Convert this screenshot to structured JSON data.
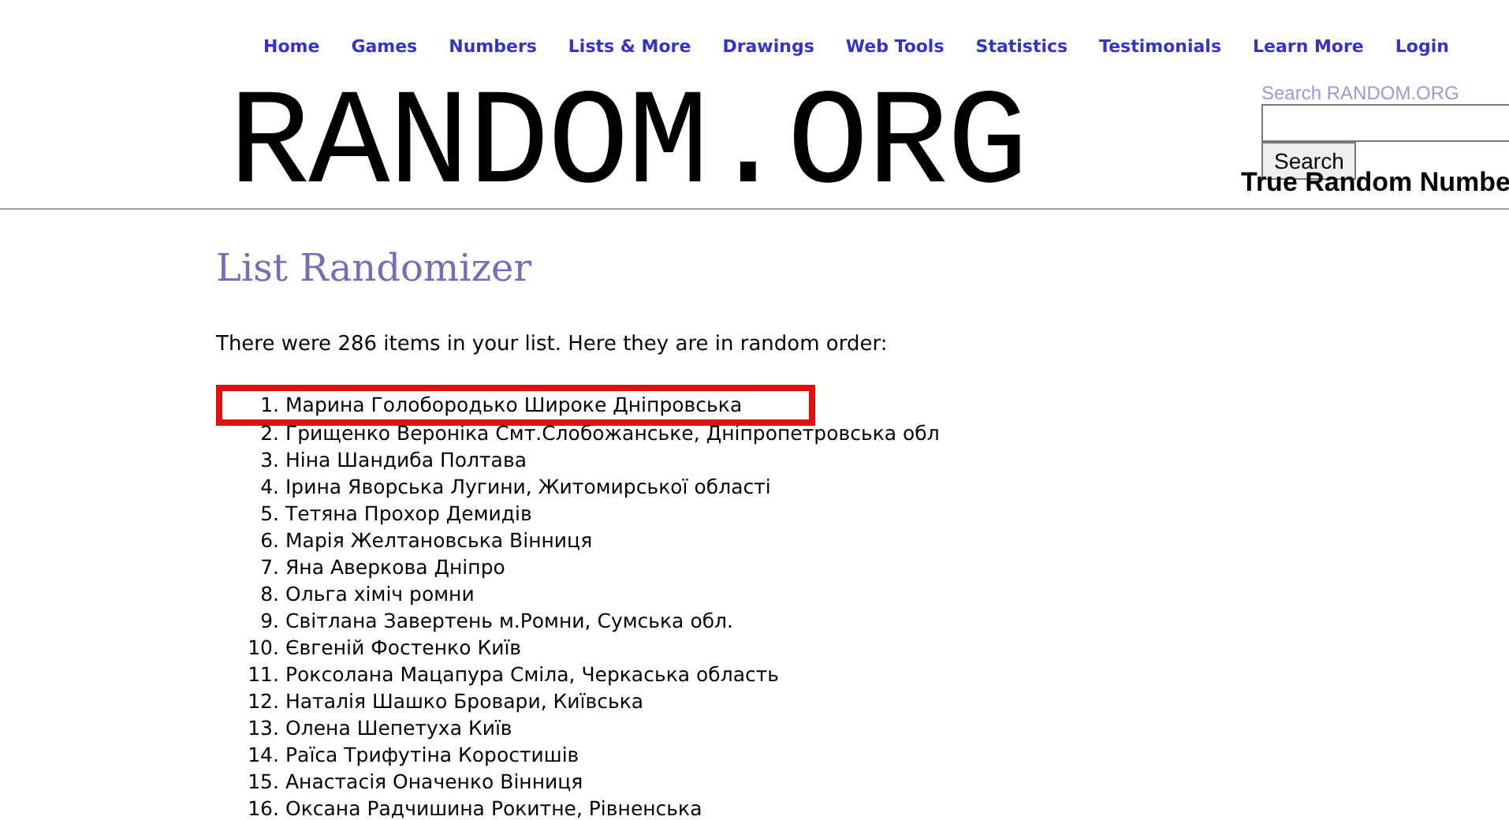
{
  "nav": [
    "Home",
    "Games",
    "Numbers",
    "Lists & More",
    "Drawings",
    "Web Tools",
    "Statistics",
    "Testimonials",
    "Learn More",
    "Login"
  ],
  "logo": "RANDOM.ORG",
  "search": {
    "label": "Search RANDOM.ORG",
    "button": "Search"
  },
  "tagline": "True Random Numbe",
  "title": "List Randomizer",
  "intro": "There were 286 items in your list. Here they are in random order:",
  "items": [
    {
      "number": "1.",
      "text": "Марина Голобородько Широке Дніпровська",
      "highlighted": true
    },
    {
      "number": "2.",
      "text": "Грищенко Вероніка Смт.Слобожанське, Дніпропетровська обл",
      "highlighted": false
    },
    {
      "number": "3.",
      "text": "Ніна Шандиба Полтава",
      "highlighted": false
    },
    {
      "number": "4.",
      "text": "Ірина Яворська Лугини, Житомирської області",
      "highlighted": false
    },
    {
      "number": "5.",
      "text": "Тетяна Прохор Демидів",
      "highlighted": false
    },
    {
      "number": "6.",
      "text": "Марія Желтановська Вінниця",
      "highlighted": false
    },
    {
      "number": "7.",
      "text": "Яна Аверкова Дніпро",
      "highlighted": false
    },
    {
      "number": "8.",
      "text": "Ольга хіміч ромни",
      "highlighted": false
    },
    {
      "number": "9.",
      "text": "Світлана Завертень м.Ромни, Сумська обл.",
      "highlighted": false
    },
    {
      "number": "10.",
      "text": "Євгеній Фостенко Київ",
      "highlighted": false
    },
    {
      "number": "11.",
      "text": "Роксолана Мацапура Сміла, Черкаська область",
      "highlighted": false
    },
    {
      "number": "12.",
      "text": "Наталія Шашко Бровари, Київська",
      "highlighted": false
    },
    {
      "number": "13.",
      "text": "Олена Шепетуха Київ",
      "highlighted": false
    },
    {
      "number": "14.",
      "text": "Раїса Трифутіна Коростишів",
      "highlighted": false
    },
    {
      "number": "15.",
      "text": "Анастасія Оначенко Вінниця",
      "highlighted": false
    },
    {
      "number": "16.",
      "text": "Оксана Радчишина Рокитне, Рівненська",
      "highlighted": false
    }
  ]
}
